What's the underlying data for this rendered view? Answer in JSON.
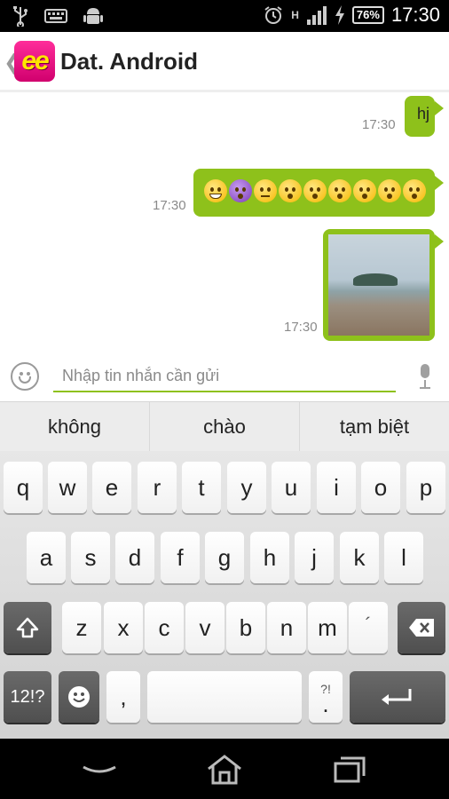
{
  "status_bar": {
    "time": "17:30",
    "battery": "76%",
    "network": "H",
    "left_icons": [
      "usb-icon",
      "keyboard-icon",
      "android-icon"
    ],
    "right_icons": [
      "alarm-icon",
      "signal-icon",
      "charging-icon",
      "battery-icon"
    ]
  },
  "header": {
    "logo_text": "ee",
    "title": "Dat. Android"
  },
  "messages": [
    {
      "type": "text",
      "text": "hj",
      "time": "17:30"
    },
    {
      "type": "emoji",
      "emoji": [
        "grin",
        "devil",
        "sad",
        "wow",
        "wow",
        "wow",
        "wow",
        "wow",
        "wow"
      ],
      "time": "17:30"
    },
    {
      "type": "image",
      "time": "17:30"
    }
  ],
  "input": {
    "placeholder": "Nhập tin nhắn cần gửi",
    "value": ""
  },
  "suggestions": [
    "không",
    "chào",
    "tạm biệt"
  ],
  "keyboard": {
    "row1": [
      "q",
      "w",
      "e",
      "r",
      "t",
      "y",
      "u",
      "i",
      "o",
      "p"
    ],
    "row2": [
      "a",
      "s",
      "d",
      "f",
      "g",
      "h",
      "j",
      "k",
      "l"
    ],
    "row3": [
      "z",
      "x",
      "c",
      "v",
      "b",
      "n",
      "m"
    ],
    "accent_key": "´",
    "numbers_key": "12!?",
    "comma_key": ",",
    "period_key": ".",
    "period_sub": "?!"
  },
  "nav_bar": {
    "icons": [
      "back-icon",
      "home-icon",
      "recent-apps-icon"
    ]
  }
}
